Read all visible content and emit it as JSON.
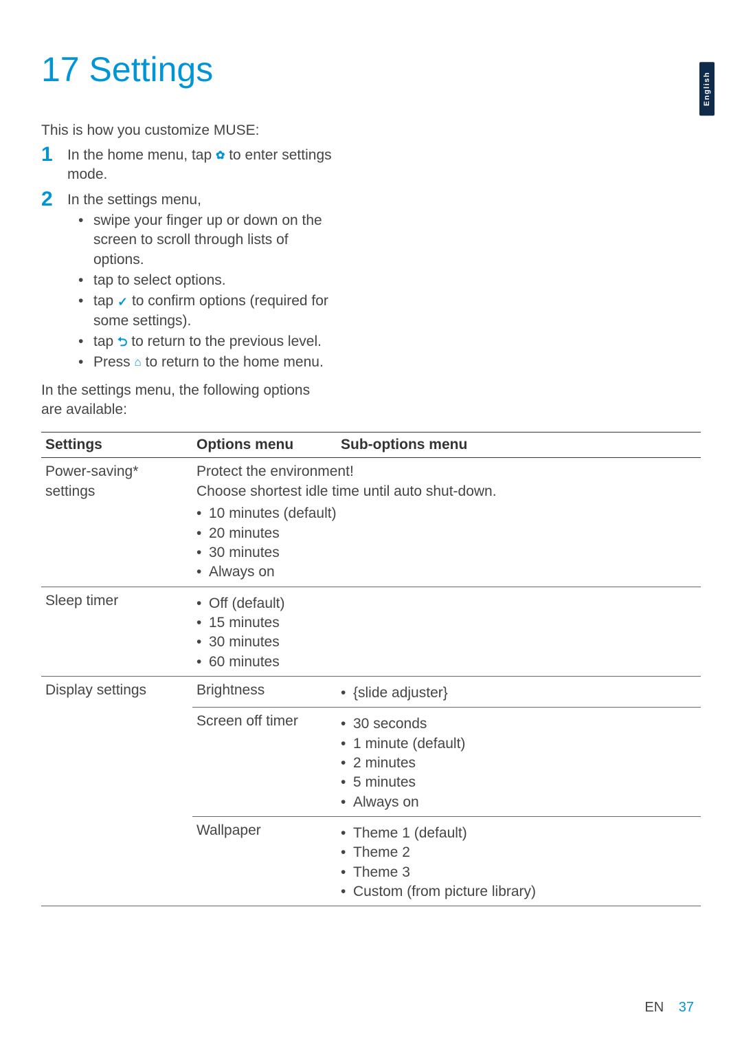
{
  "side_tab": "English",
  "chapter": {
    "number": "17",
    "title": "Settings"
  },
  "intro": "This is how you customize MUSE:",
  "steps": [
    {
      "num": "1",
      "pre": "In the home menu, tap ",
      "icon": "gear",
      "post": " to enter settings mode.",
      "bullets": []
    },
    {
      "num": "2",
      "pre": "In the settings menu,",
      "icon": "",
      "post": "",
      "bullets": [
        {
          "text": "swipe your finger up or down on the screen to scroll through lists of options."
        },
        {
          "text": "tap to select options."
        },
        {
          "pre": "tap ",
          "icon": "check",
          "post": " to confirm options (required for some settings)."
        },
        {
          "pre": "tap ",
          "icon": "back",
          "post": " to return to the previous level."
        },
        {
          "pre": "Press ",
          "icon": "home",
          "post": " to return to the home menu."
        }
      ]
    }
  ],
  "post_steps": "In the settings menu, the following options are available:",
  "table": {
    "headers": [
      "Settings",
      "Options menu",
      "Sub-options menu"
    ],
    "rows": [
      {
        "setting": "Power-saving* settings",
        "option_intro1": "Protect the environment!",
        "option_intro2": "Choose shortest idle time until auto shut-down.",
        "options": [
          "10 minutes (default)",
          "20 minutes",
          "30 minutes",
          "Always on"
        ],
        "sub": []
      },
      {
        "setting": "Sleep timer",
        "options": [
          "Off (default)",
          "15 minutes",
          "30 minutes",
          "60 minutes"
        ],
        "sub": []
      },
      {
        "setting": "Display settings",
        "subrows": [
          {
            "option": "Brightness",
            "sub": [
              "{slide adjuster}"
            ]
          },
          {
            "option": "Screen off timer",
            "sub": [
              "30 seconds",
              "1 minute (default)",
              "2 minutes",
              "5 minutes",
              "Always on"
            ]
          },
          {
            "option": "Wallpaper",
            "sub": [
              "Theme 1 (default)",
              "Theme 2",
              "Theme 3",
              "Custom (from picture library)"
            ]
          }
        ]
      }
    ]
  },
  "footer": {
    "lang": "EN",
    "page": "37"
  },
  "icons": {
    "gear": "✿",
    "check": "✓",
    "back": "⮌",
    "home": "⌂"
  }
}
